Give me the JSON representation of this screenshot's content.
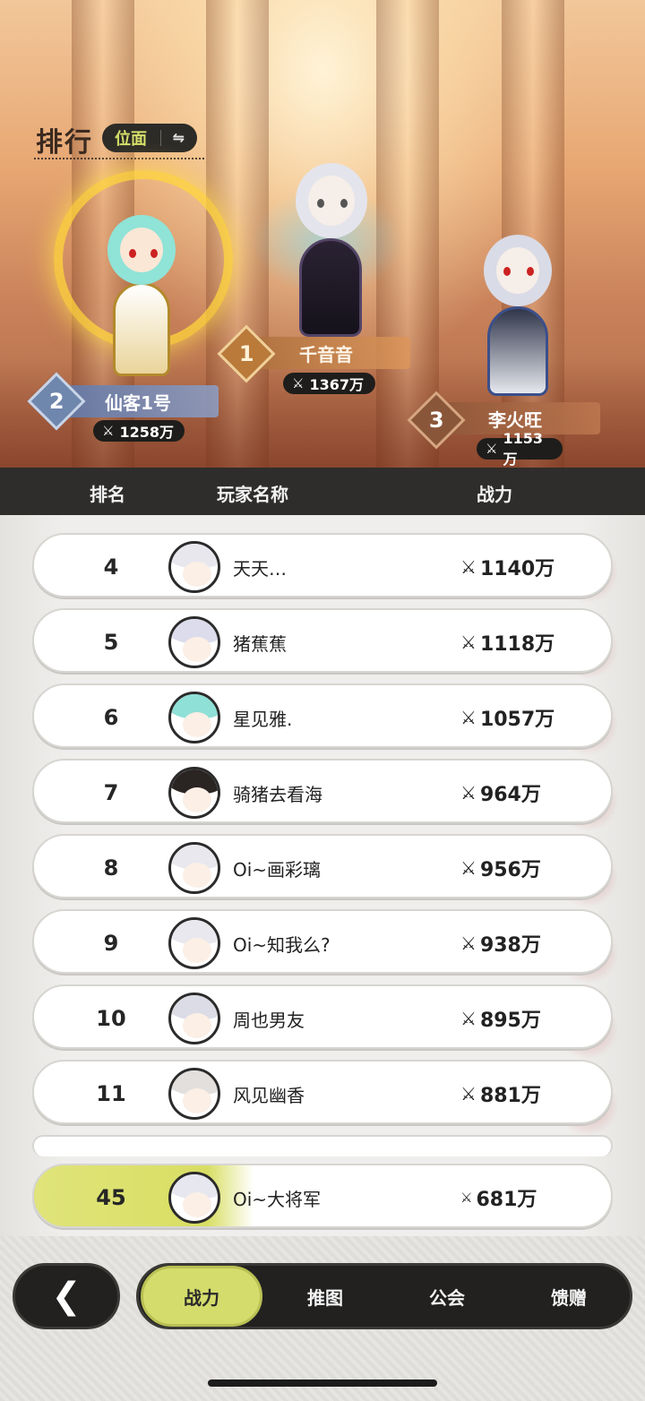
{
  "header": {
    "title": "排行",
    "scope_label": "位面",
    "scope_switch_icon": "⇋"
  },
  "podium": [
    {
      "rank": "1",
      "name": "千音音",
      "power": "1367万"
    },
    {
      "rank": "2",
      "name": "仙客1号",
      "power": "1258万"
    },
    {
      "rank": "3",
      "name": "李火旺",
      "power": "1153万"
    }
  ],
  "table": {
    "columns": [
      "排名",
      "玩家名称",
      "战力"
    ],
    "rows": [
      {
        "rank": "4",
        "name": "天天…",
        "power": "1140万"
      },
      {
        "rank": "5",
        "name": "猪蕉蕉",
        "power": "1118万"
      },
      {
        "rank": "6",
        "name": "星见雅.",
        "power": "1057万"
      },
      {
        "rank": "7",
        "name": "骑猪去看海",
        "power": "964万"
      },
      {
        "rank": "8",
        "name": "Oi~画彩璃",
        "power": "956万"
      },
      {
        "rank": "9",
        "name": "Oi~知我么?",
        "power": "938万"
      },
      {
        "rank": "10",
        "name": "周也男友",
        "power": "895万"
      },
      {
        "rank": "11",
        "name": "风见幽香",
        "power": "881万"
      }
    ]
  },
  "my_rank": {
    "rank": "45",
    "name": "Oi~大将军",
    "power": "681万"
  },
  "power_icon": "sword-cross-icon",
  "nav": {
    "back_icon": "❮",
    "tabs": [
      {
        "label": "战力",
        "active": true
      },
      {
        "label": "推图",
        "active": false
      },
      {
        "label": "公会",
        "active": false
      },
      {
        "label": "馈赠",
        "active": false
      }
    ]
  },
  "colors": {
    "accent": "#d4dc6b",
    "dark": "#222120",
    "header_bar": "#2e2d2b"
  }
}
